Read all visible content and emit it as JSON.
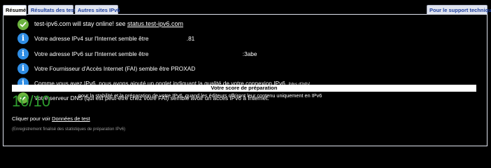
{
  "tabs": {
    "summary": "Résumé",
    "results": "Résultats des tests",
    "other_sites": "Autres sites IPv6",
    "support": "Pour le support technique"
  },
  "rows": [
    {
      "status": "ok",
      "text": "test-ipv6.com will stay online! see ",
      "link": "status.test-ipv6.com"
    },
    {
      "status": "info",
      "text": "Votre adresse IPv4 sur l'Internet semble être ",
      "suffix": ".81"
    },
    {
      "status": "info",
      "text": "Votre adresse IPv6 sur l'Internet semble être ",
      "suffix": ":3abe"
    },
    {
      "status": "info",
      "text": "Votre Fournisseur d'Accès Internet (FAI) semble être PROXAD"
    },
    {
      "status": "info",
      "text": "Comme vous avez IPv6, nous avons ajouté un onglet indiquant la qualité de votre connexion IPv6. ",
      "link": "[plus d'info]"
    },
    {
      "status": "ok",
      "text": "Votre serveur DNS (qui est peut-être chez votre FAI) semble avoir un accès IPv6 à Internet."
    }
  ],
  "score": {
    "heading": "Votre score de préparation",
    "value": "10/10",
    "description": "pour la stabilité et la préparation de votre IPv6, quand les éditeurs offriront leur contenu uniquement en IPv6"
  },
  "test_data": {
    "prefix": "Cliquer pour voir ",
    "link": "Données de test"
  },
  "footnote": "(Enregistrement finalisé des statistiques de préparation IPv6)",
  "colors": {
    "ok": "#6cb33f",
    "info": "#2f8de4",
    "score": "#2e9b2e"
  }
}
